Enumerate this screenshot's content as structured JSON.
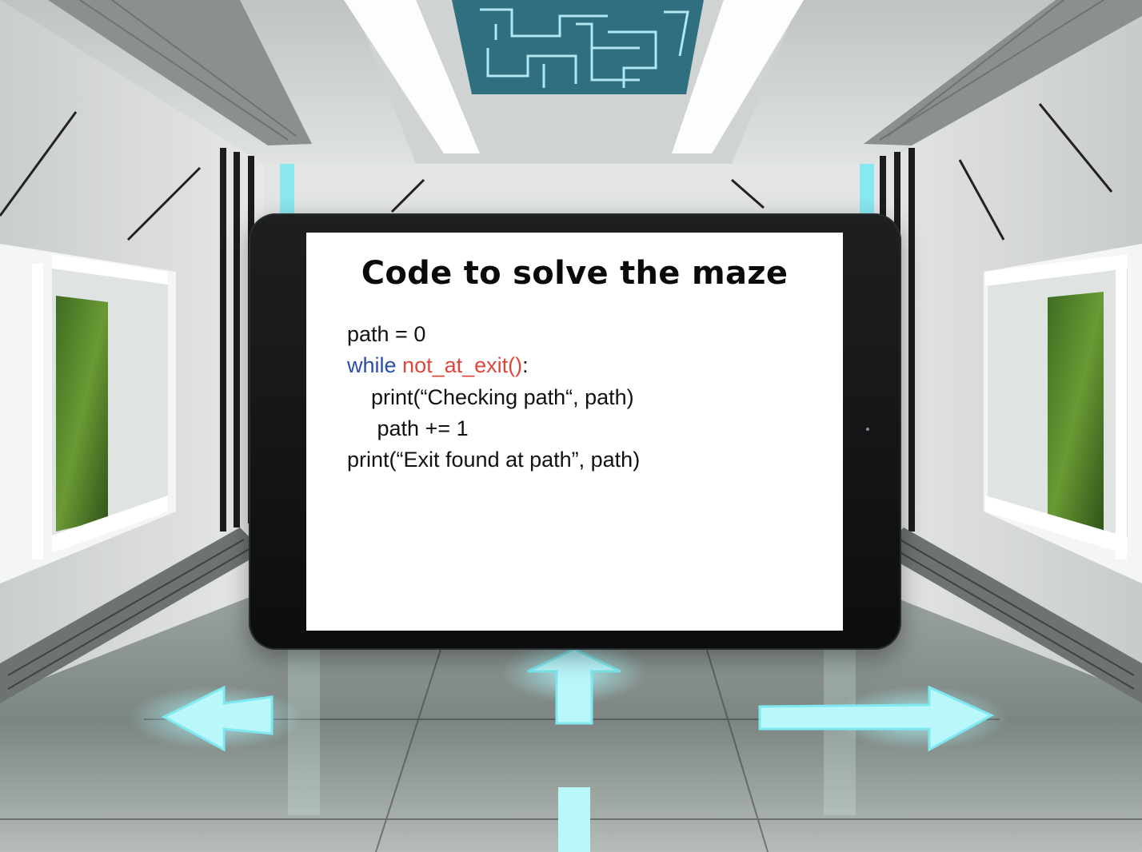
{
  "tablet": {
    "title": "Code to solve the maze",
    "code": {
      "line1": "path = 0",
      "line2_keyword": "while",
      "line2_space": " ",
      "line2_call": "not_at_exit()",
      "line2_colon": ":",
      "line3_indent": "    ",
      "line3": "print(“Checking path“, path)",
      "line4_indent": "     ",
      "line4": "path += 1",
      "line5": "print(“Exit found at path”, path)"
    }
  },
  "colors": {
    "keyword": "#2a4ea5",
    "function_call": "#e0453a",
    "screen_background": "#ffffff",
    "tablet_bezel": "#141516",
    "corridor_light": "#6fe6f0"
  },
  "icons": {
    "floor_arrows": [
      "arrow-left-icon",
      "arrow-up-icon",
      "arrow-right-icon"
    ]
  }
}
